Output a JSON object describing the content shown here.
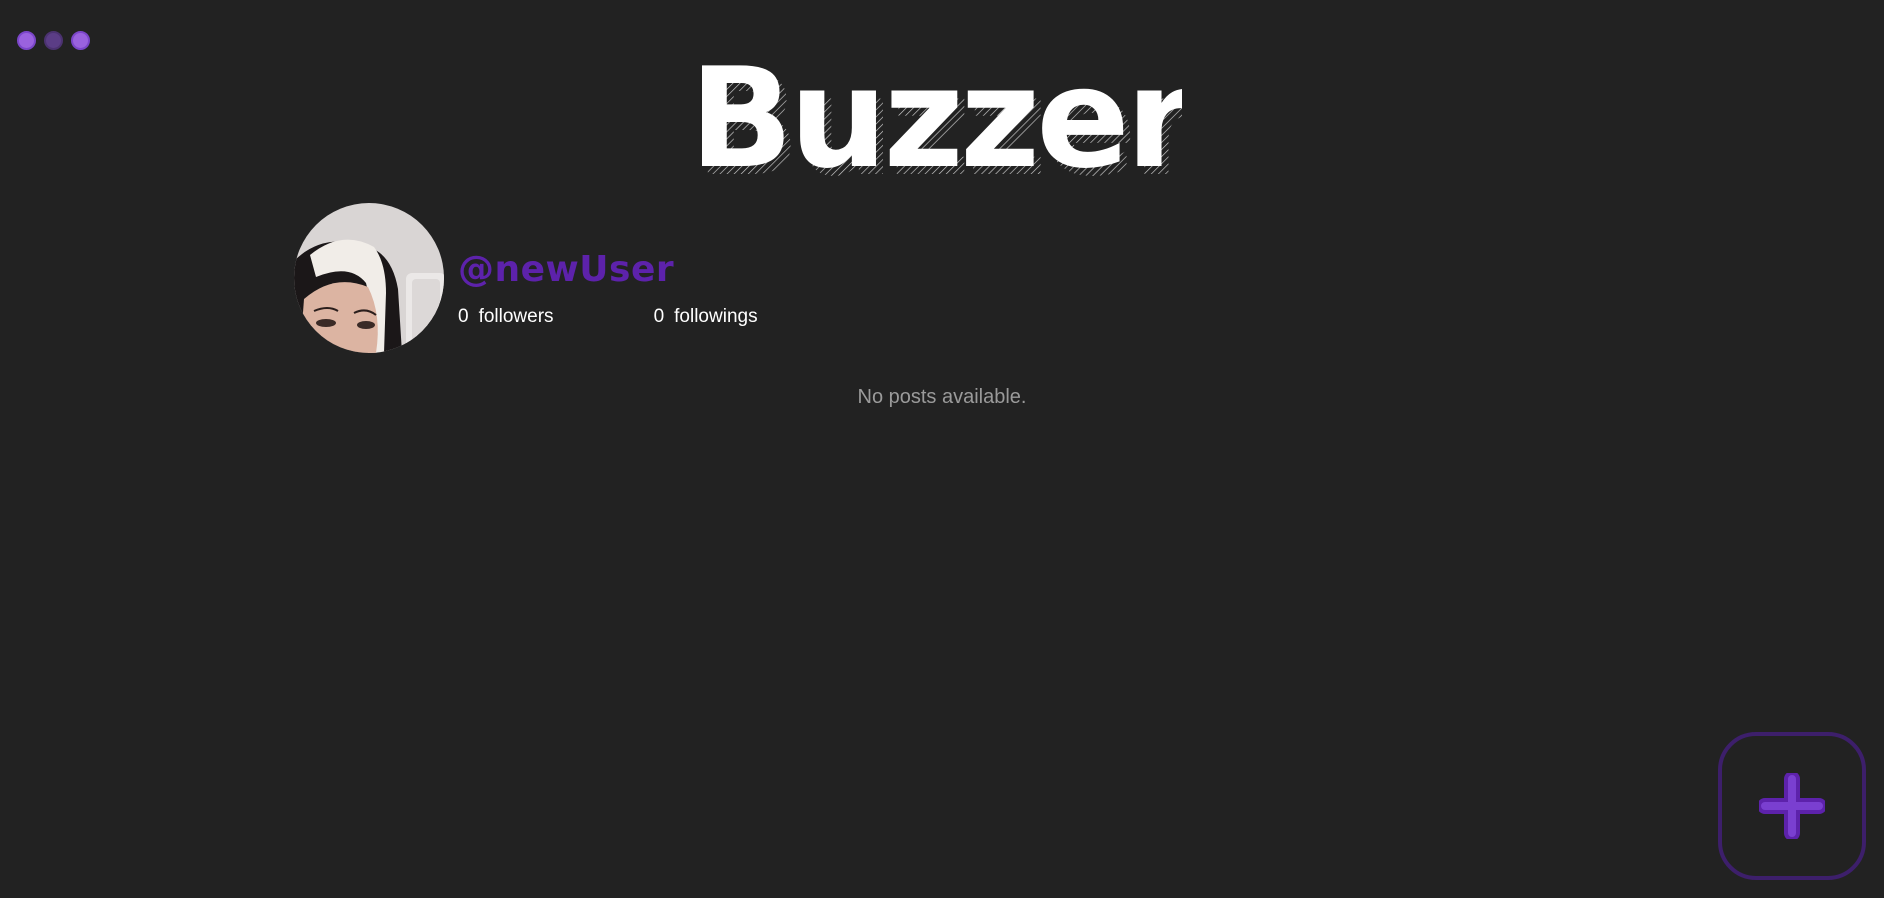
{
  "app": {
    "title": "Buzzer"
  },
  "window_controls": [
    {
      "name": "control-dot-1"
    },
    {
      "name": "control-dot-2"
    },
    {
      "name": "control-dot-3"
    }
  ],
  "profile": {
    "username": "@newUser",
    "followers_count": "0",
    "followers_label": "followers",
    "followings_count": "0",
    "followings_label": "followings"
  },
  "posts": {
    "empty_message": "No posts available."
  },
  "add_button": {
    "icon": "plus-icon"
  },
  "colors": {
    "background": "#222222",
    "accent": "#5d22ab",
    "logo": "#ffffff",
    "muted_text": "#9a9a9a",
    "add_button_border": "#3d1f6b"
  }
}
